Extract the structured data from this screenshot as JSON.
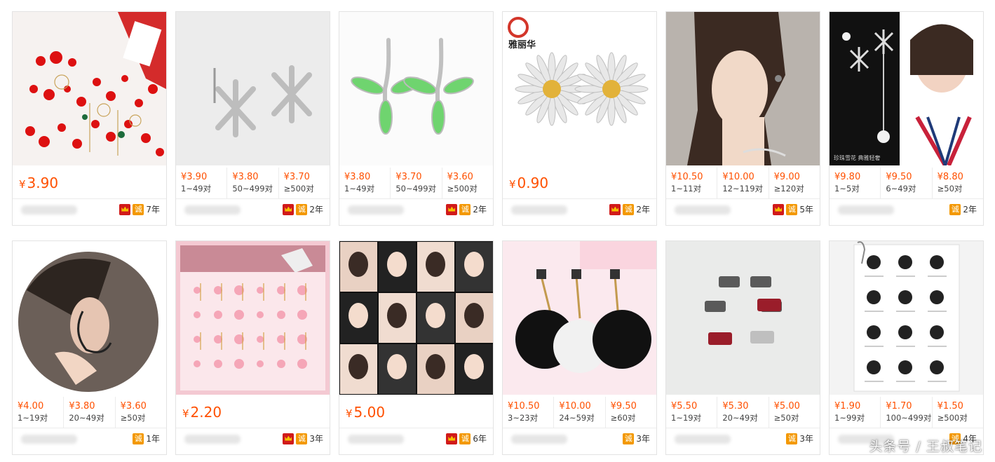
{
  "currency_symbol": "¥",
  "watermark": "头条号 / 王叔笔记",
  "colors": {
    "price": "#ff5000",
    "crown_badge": "#d11a1a",
    "cheng_badge": "#f39800"
  },
  "products": [
    {
      "thumb": "red-earrings-collection",
      "single_price": "3.90",
      "badges": [
        "crown",
        "cheng"
      ],
      "cheng_label": "诚",
      "years": "7年"
    },
    {
      "thumb": "silver-snowflake-studs",
      "tiers": [
        {
          "price": "¥3.90",
          "qty": "1~49对"
        },
        {
          "price": "¥3.80",
          "qty": "50~499对"
        },
        {
          "price": "¥3.70",
          "qty": "≥500对"
        }
      ],
      "badges": [
        "crown",
        "cheng"
      ],
      "cheng_label": "诚",
      "years": "2年"
    },
    {
      "thumb": "green-leaf-studs",
      "tiers": [
        {
          "price": "¥3.80",
          "qty": "1~49对"
        },
        {
          "price": "¥3.70",
          "qty": "50~499对"
        },
        {
          "price": "¥3.60",
          "qty": "≥500对"
        }
      ],
      "badges": [
        "crown",
        "cheng"
      ],
      "cheng_label": "诚",
      "years": "2年"
    },
    {
      "thumb": "daisy-studs",
      "logo_text": "雅丽华",
      "single_price": "0.90",
      "badges": [
        "crown",
        "cheng"
      ],
      "cheng_label": "诚",
      "years": "2年"
    },
    {
      "thumb": "model-portrait",
      "tiers": [
        {
          "price": "¥10.50",
          "qty": "1~11对"
        },
        {
          "price": "¥10.00",
          "qty": "12~119对"
        },
        {
          "price": "¥9.00",
          "qty": "≥120对"
        }
      ],
      "badges": [
        "crown",
        "cheng"
      ],
      "cheng_label": "诚",
      "years": "5年"
    },
    {
      "thumb": "snowflake-drop-model",
      "image_caption": "珍珠雪花 典雅轻奢",
      "tiers": [
        {
          "price": "¥9.80",
          "qty": "1~5对"
        },
        {
          "price": "¥9.50",
          "qty": "6~49对"
        },
        {
          "price": "¥8.80",
          "qty": "≥50对"
        }
      ],
      "badges": [
        "cheng"
      ],
      "cheng_label": "诚",
      "years": "2年"
    },
    {
      "thumb": "ear-closeup",
      "tiers": [
        {
          "price": "¥4.00",
          "qty": "1~19对"
        },
        {
          "price": "¥3.80",
          "qty": "20~49对"
        },
        {
          "price": "¥3.60",
          "qty": "≥50对"
        }
      ],
      "badges": [
        "cheng"
      ],
      "cheng_label": "诚",
      "years": "1年"
    },
    {
      "thumb": "pink-earrings-collection",
      "single_price": "2.20",
      "badges": [
        "crown",
        "cheng"
      ],
      "cheng_label": "诚",
      "years": "3年"
    },
    {
      "thumb": "celebrity-collage",
      "single_price": "5.00",
      "badges": [
        "crown",
        "cheng"
      ],
      "cheng_label": "诚",
      "years": "6年"
    },
    {
      "thumb": "fur-pompom-earrings",
      "tiers": [
        {
          "price": "¥10.50",
          "qty": "3~23对"
        },
        {
          "price": "¥10.00",
          "qty": "24~59对"
        },
        {
          "price": "¥9.50",
          "qty": "≥60对"
        }
      ],
      "badges": [
        "cheng"
      ],
      "cheng_label": "诚",
      "years": "3年"
    },
    {
      "thumb": "scottie-dog-studs",
      "tiers": [
        {
          "price": "¥5.50",
          "qty": "1~19对"
        },
        {
          "price": "¥5.30",
          "qty": "20~49对"
        },
        {
          "price": "¥5.00",
          "qty": "≥50对"
        }
      ],
      "badges": [
        "cheng"
      ],
      "cheng_label": "诚",
      "years": "3年"
    },
    {
      "thumb": "zodiac-studs-card",
      "tiers": [
        {
          "price": "¥1.90",
          "qty": "1~99对"
        },
        {
          "price": "¥1.70",
          "qty": "100~499对"
        },
        {
          "price": "¥1.50",
          "qty": "≥500对"
        }
      ],
      "badges": [
        "cheng"
      ],
      "cheng_label": "诚",
      "years": "4年"
    }
  ]
}
